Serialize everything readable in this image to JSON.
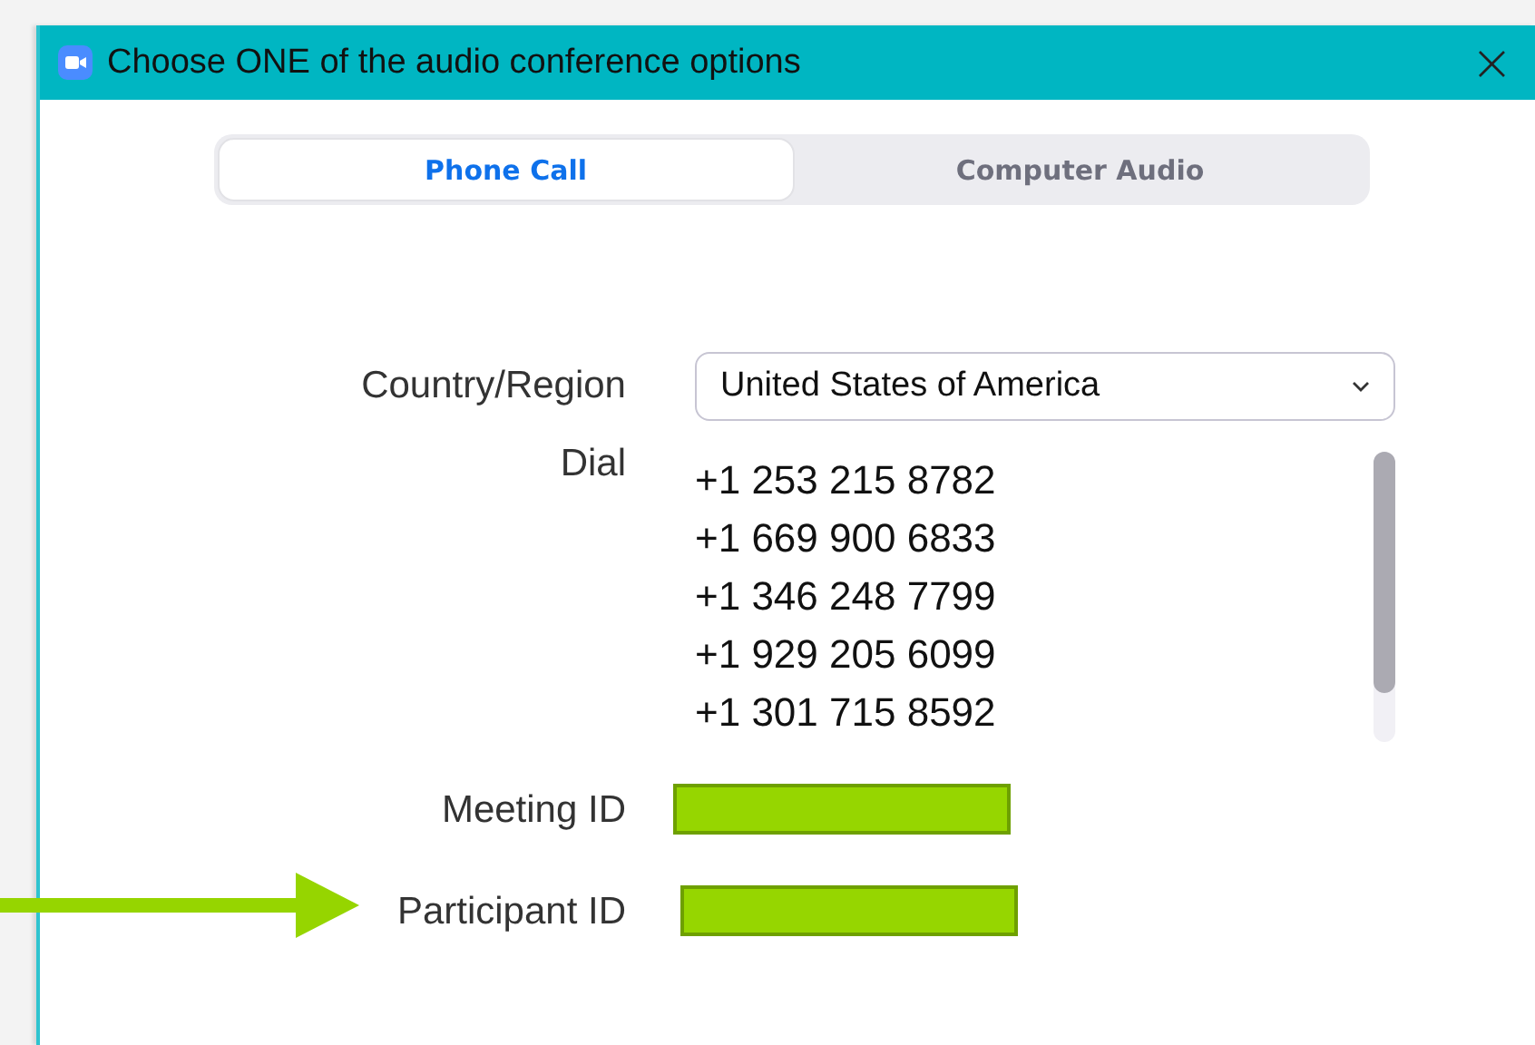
{
  "window": {
    "title": "Choose ONE of the audio conference options",
    "close": "×"
  },
  "tabs": [
    {
      "label": "Phone Call",
      "selected": true
    },
    {
      "label": "Computer Audio",
      "selected": false
    }
  ],
  "country": {
    "label": "Country/Region",
    "value": "United States of America"
  },
  "dial": {
    "label": "Dial",
    "numbers": [
      "+1 253 215 8782",
      "+1 669 900 6833",
      "+1 346 248 7799",
      "+1 929 205 6099",
      "+1 301 715 8592"
    ]
  },
  "ids": [
    {
      "label": "Meeting ID",
      "redacted": true,
      "pointed": false
    },
    {
      "label": "Participant ID",
      "redacted": true,
      "pointed": true
    }
  ]
}
